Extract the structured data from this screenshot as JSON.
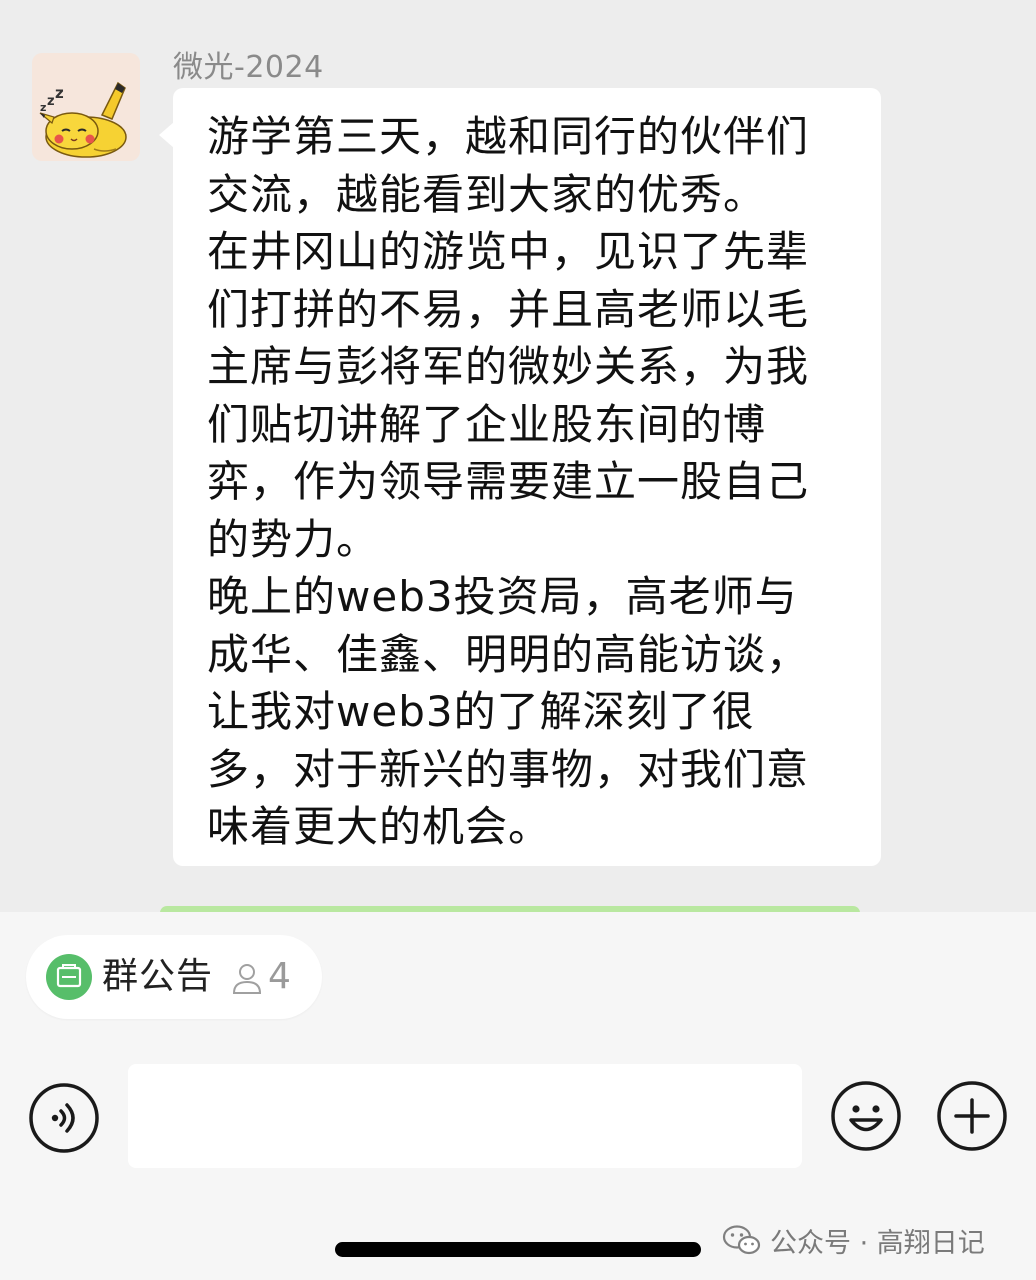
{
  "chat": {
    "sender": {
      "name": "微光-2024",
      "avatar": "sleeping-pikachu-avatar"
    },
    "message_lines": [
      "游学第三天，越和同行的伙伴们",
      "交流，越能看到大家的优秀。",
      "在井冈山的游览中，见识了先辈",
      "们打拼的不易，并且高老师以毛",
      "主席与彭将军的微妙关系，为我",
      "们贴切讲解了企业股东间的博",
      "弈，作为领导需要建立一股自己",
      "的势力。",
      "晚上的web3投资局，高老师与",
      "成华、佳鑫、明明的高能访谈，",
      "让我对web3的了解深刻了很",
      "多，对于新兴的事物，对我们意",
      "味着更大的机会。"
    ]
  },
  "announcement": {
    "label": "群公告",
    "member_count": "4",
    "icon": "announcement-icon"
  },
  "input_bar": {
    "voice_icon": "voice-icon",
    "text_value": "",
    "emoji_icon": "emoji-icon",
    "plus_icon": "plus-icon"
  },
  "watermark": {
    "text": "公众号 · 高翔日记",
    "icon": "wechat-logo-icon"
  },
  "colors": {
    "chat_bg": "#ededed",
    "bubble": "#ffffff",
    "accent_green": "#57be6a",
    "bottom_bg": "#f6f6f6"
  }
}
